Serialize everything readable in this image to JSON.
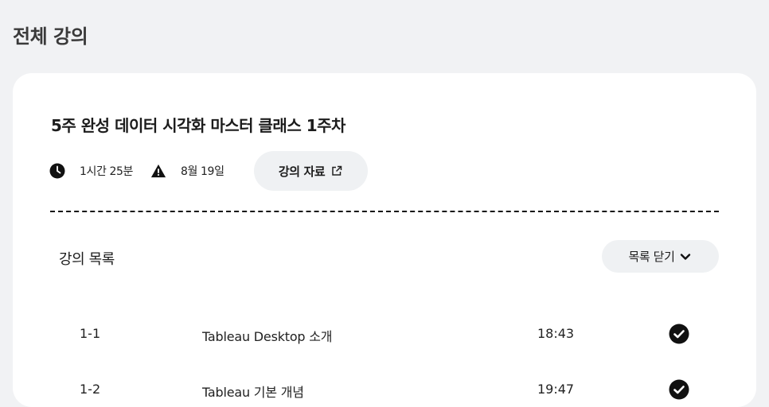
{
  "page": {
    "title": "전체 강의"
  },
  "course": {
    "title": "5주 완성 데이터 시각화 마스터 클래스 1주차",
    "duration": "1시간 25분",
    "date": "8월 19일",
    "materials_label": "강의 자료"
  },
  "lecture_list": {
    "heading": "강의 목록",
    "close_label": "목록 닫기",
    "items": [
      {
        "number": "1-1",
        "title": "Tableau Desktop 소개",
        "duration": "18:43",
        "completed": true
      },
      {
        "number": "1-2",
        "title": "Tableau 기본 개념",
        "duration": "19:47",
        "completed": true
      }
    ]
  },
  "icons": {
    "duration": "clock-icon",
    "date": "warning-icon",
    "materials": "external-link-icon",
    "close_list": "chevron-down-icon",
    "completed": "check-circle-icon"
  },
  "colors": {
    "background": "#f1f2f4",
    "card": "#ffffff",
    "button": "#eff1f3",
    "text": "#1c1c1c"
  }
}
